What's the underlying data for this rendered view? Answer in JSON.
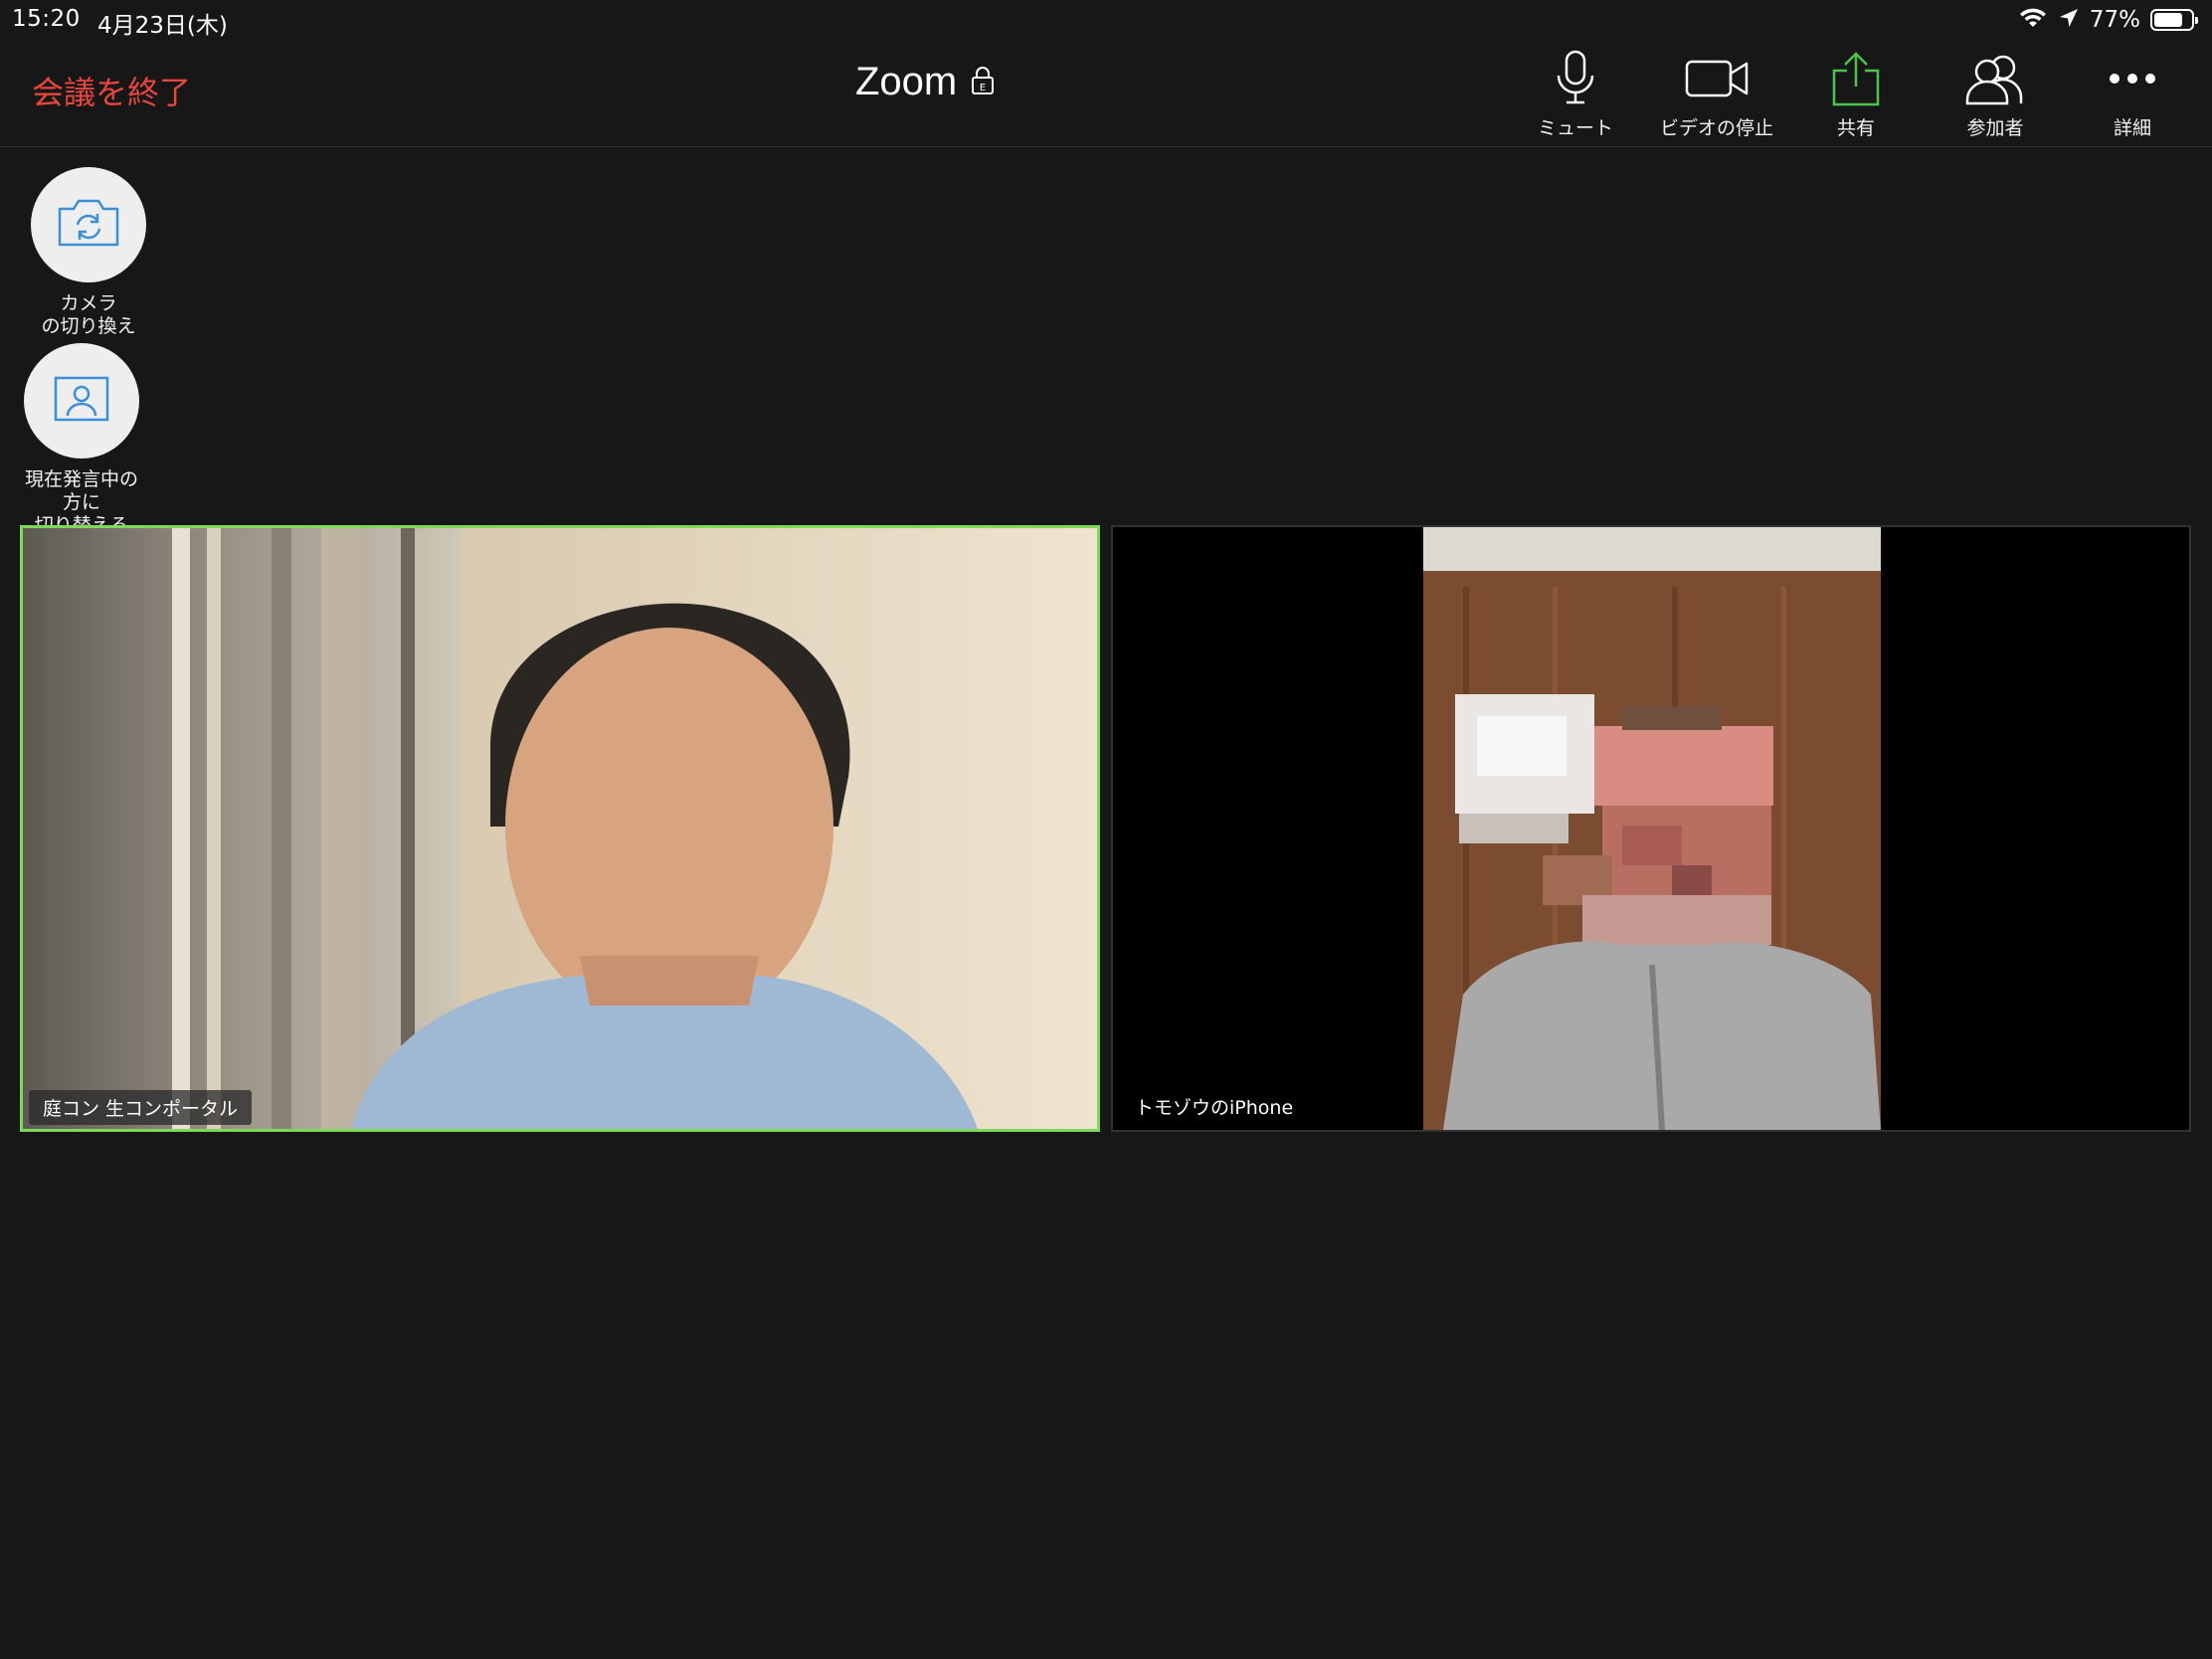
{
  "status_bar": {
    "time": "15:20",
    "date": "4月23日(木)",
    "battery_percent": "77%",
    "battery_level": 0.77
  },
  "toolbar": {
    "end_meeting_label": "会議を終了",
    "title": "Zoom",
    "lock_icon": "lock-icon",
    "buttons": [
      {
        "id": "mute",
        "label": "ミュート",
        "icon": "microphone-icon"
      },
      {
        "id": "stop-video",
        "label": "ビデオの停止",
        "icon": "video-camera-icon"
      },
      {
        "id": "share",
        "label": "共有",
        "icon": "share-upload-icon"
      },
      {
        "id": "participants",
        "label": "参加者",
        "icon": "participants-icon"
      },
      {
        "id": "more",
        "label": "詳細",
        "icon": "more-dots-icon"
      }
    ]
  },
  "floating_controls": {
    "switch_camera": {
      "label": "カメラ\nの切り換え",
      "icon": "camera-switch-icon"
    },
    "switch_speaker": {
      "label": "現在発言中の\n方に\n切り替える",
      "icon": "speaker-view-icon"
    }
  },
  "colors": {
    "background": "#171717",
    "end_meeting": "#e8463c",
    "active_speaker_border": "#7ed958",
    "share_icon": "#4cc34a"
  },
  "videos": [
    {
      "name": "庭コン 生コンポータル",
      "active_speaker": true
    },
    {
      "name": "トモゾウのiPhone",
      "active_speaker": false
    }
  ]
}
